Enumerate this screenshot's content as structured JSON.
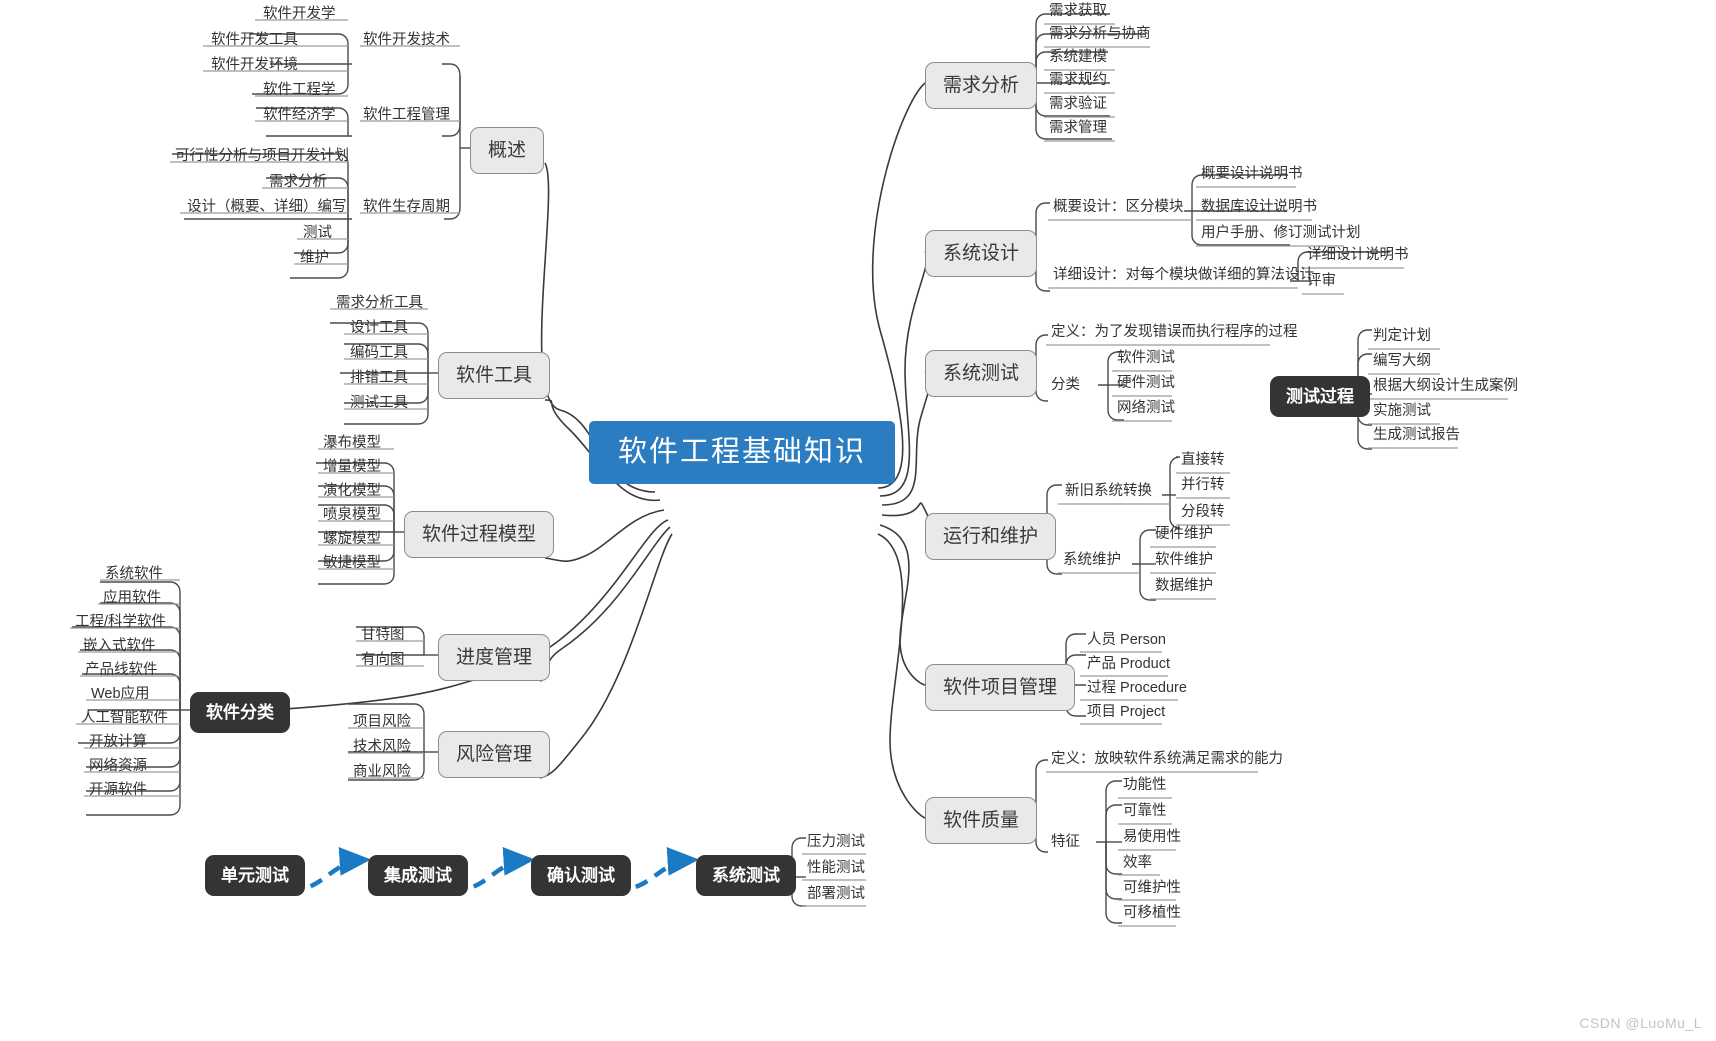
{
  "root": {
    "label": "软件工程基础知识",
    "color": "#2b7cc0"
  },
  "watermark": "CSDN @LuoMu_L",
  "branches": {
    "gaishu": {
      "label": "概述",
      "children": [
        {
          "label": "软件开发技术",
          "leaves": [
            "软件开发学",
            "软件开发工具",
            "软件开发环境"
          ]
        },
        {
          "label": "软件工程管理",
          "leaves": [
            "软件工程学",
            "软件经济学"
          ]
        },
        {
          "label": "软件生存周期",
          "leaves": [
            "可行性分析与项目开发计划",
            "需求分析",
            "设计（概要、详细）编写",
            "测试",
            "维护"
          ]
        }
      ]
    },
    "ruanjian_gongju": {
      "label": "软件工具",
      "leaves": [
        "需求分析工具",
        "设计工具",
        "编码工具",
        "排错工具",
        "测试工具"
      ]
    },
    "guocheng_moxing": {
      "label": "软件过程模型",
      "leaves": [
        "瀑布模型",
        "增量模型",
        "演化模型",
        "喷泉模型",
        "螺旋模型",
        "敏捷模型"
      ]
    },
    "ruanjian_fenlei": {
      "label": "软件分类",
      "leaves": [
        "系统软件",
        "应用软件",
        "工程/科学软件",
        "嵌入式软件",
        "产品线软件",
        "Web应用",
        "人工智能软件",
        "开放计算",
        "网络资源",
        "开源软件"
      ]
    },
    "jindu_guanli": {
      "label": "进度管理",
      "leaves": [
        "甘特图",
        "有向图"
      ]
    },
    "fengxian_guanli": {
      "label": "风险管理",
      "leaves": [
        "项目风险",
        "技术风险",
        "商业风险"
      ]
    },
    "xuqiu_fenxi": {
      "label": "需求分析",
      "leaves": [
        "需求获取",
        "需求分析与协商",
        "系统建模",
        "需求规约",
        "需求验证",
        "需求管理"
      ]
    },
    "xitong_sheji": {
      "label": "系统设计",
      "children": [
        {
          "label": "概要设计：区分模块",
          "leaves": [
            "概要设计说明书",
            "数据库设计说明书",
            "用户手册、修订测试计划"
          ]
        },
        {
          "label": "详细设计：对每个模块做详细的算法设计",
          "leaves": [
            "详细设计说明书",
            "评审"
          ]
        }
      ]
    },
    "xitong_ceshi": {
      "label": "系统测试",
      "definition": "定义：为了发现错误而执行程序的过程",
      "group_label": "分类",
      "group_leaves": [
        "软件测试",
        "硬件测试",
        "网络测试"
      ]
    },
    "ceshi_guocheng": {
      "label": "测试过程",
      "leaves": [
        "判定计划",
        "编写大纲",
        "根据大纲设计生成案例",
        "实施测试",
        "生成测试报告"
      ]
    },
    "yunxing_weihu": {
      "label": "运行和维护",
      "children": [
        {
          "label": "新旧系统转换",
          "leaves": [
            "直接转",
            "并行转",
            "分段转"
          ]
        },
        {
          "label": "系统维护",
          "leaves": [
            "硬件维护",
            "软件维护",
            "数据维护"
          ]
        }
      ]
    },
    "xiangmu_guanli": {
      "label": "软件项目管理",
      "leaves": [
        "人员 Person",
        "产品 Product",
        "过程 Procedure",
        "项目 Project"
      ]
    },
    "ruanjian_zhiliang": {
      "label": "软件质量",
      "definition": "定义：放映软件系统满足需求的能力",
      "group_label": "特征",
      "group_leaves": [
        "功能性",
        "可靠性",
        "易使用性",
        "效率",
        "可维护性",
        "可移植性"
      ]
    },
    "testflow": {
      "steps": [
        "单元测试",
        "集成测试",
        "确认测试",
        "系统测试"
      ],
      "arrow_color": "#1a7bc4",
      "system_test_leaves": [
        "压力测试",
        "性能测试",
        "部署测试"
      ]
    }
  }
}
